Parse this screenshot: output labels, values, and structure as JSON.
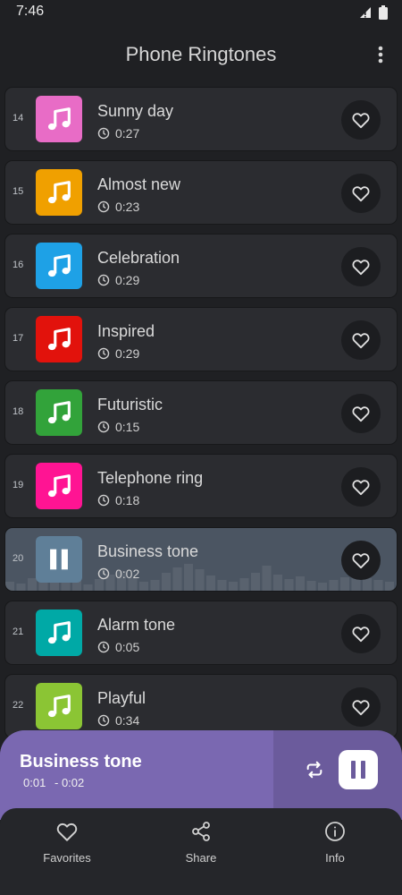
{
  "status": {
    "time": "7:46"
  },
  "app": {
    "title": "Phone Ringtones"
  },
  "ringtones": [
    {
      "index": "14",
      "title": "Sunny day",
      "duration": "0:27",
      "color": "#e86cc6",
      "playing": false
    },
    {
      "index": "15",
      "title": "Almost new",
      "duration": "0:23",
      "color": "#f0a000",
      "playing": false
    },
    {
      "index": "16",
      "title": "Celebration",
      "duration": "0:29",
      "color": "#1ea1e6",
      "playing": false
    },
    {
      "index": "17",
      "title": "Inspired",
      "duration": "0:29",
      "color": "#e2120c",
      "playing": false
    },
    {
      "index": "18",
      "title": "Futuristic",
      "duration": "0:15",
      "color": "#32a33a",
      "playing": false
    },
    {
      "index": "19",
      "title": "Telephone ring",
      "duration": "0:18",
      "color": "#ff1493",
      "playing": false
    },
    {
      "index": "20",
      "title": "Business tone",
      "duration": "0:02",
      "color": "#5f7f98",
      "playing": true
    },
    {
      "index": "21",
      "title": "Alarm tone",
      "duration": "0:05",
      "color": "#00a9a6",
      "playing": false
    },
    {
      "index": "22",
      "title": "Playful",
      "duration": "0:34",
      "color": "#8bc534",
      "playing": false
    }
  ],
  "player": {
    "title": "Business tone",
    "elapsed": "0:01",
    "remaining": "- 0:02",
    "progress_fraction": 0.68,
    "accent": "#6b5b9c"
  },
  "nav": {
    "favorites": "Favorites",
    "share": "Share",
    "info": "Info"
  }
}
